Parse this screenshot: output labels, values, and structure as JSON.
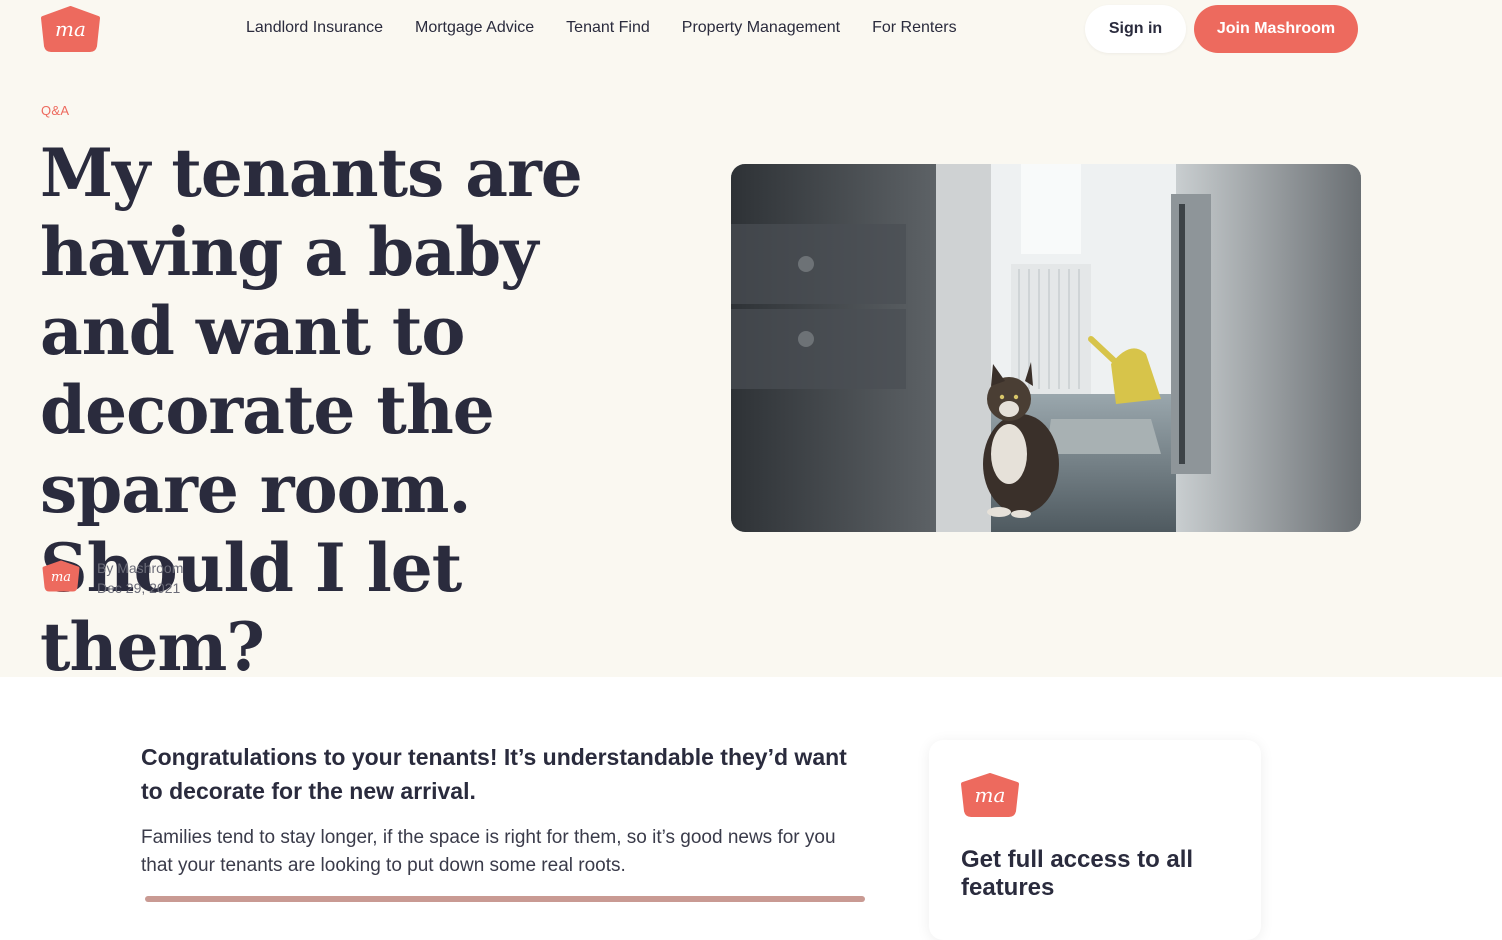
{
  "brand": {
    "logo_text": "ma",
    "color": "#ed6a5e"
  },
  "nav": {
    "items": [
      {
        "label": "Landlord Insurance"
      },
      {
        "label": "Mortgage Advice"
      },
      {
        "label": "Tenant Find"
      },
      {
        "label": "Property Management"
      },
      {
        "label": "For Renters"
      }
    ],
    "sign_in_label": "Sign in",
    "join_label": "Join Mashroom"
  },
  "article": {
    "category": "Q&A",
    "title": "My tenants are having a baby and want to decorate the spare room. Should I let them?",
    "author": "By Mashroom",
    "date": "Dec 29, 2021",
    "hero_image": "photo-cat-in-kitchen",
    "intro": "Congratulations to your tenants! It’s understandable they’d want to decorate for the new arrival.",
    "paragraph": "Families tend to stay longer, if the space is right for them, so it’s good news for you that your tenants are looking to put down some real roots."
  },
  "cta": {
    "title": "Get full access to all features"
  },
  "colors": {
    "hero_bg": "#faf8f1",
    "text_dark": "#2a2b3d",
    "accent": "#ed6a5e"
  }
}
